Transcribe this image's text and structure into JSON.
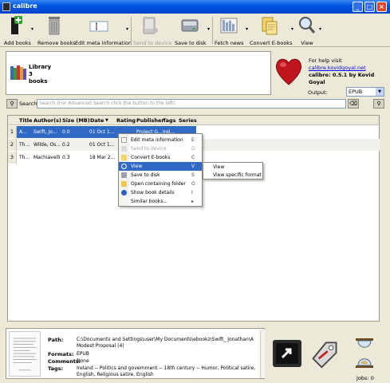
{
  "window": {
    "title": "calibre"
  },
  "toolbar": {
    "add_books": "Add books",
    "remove_books": "Remove books",
    "edit_meta": "Edit meta information",
    "send_to_device": "Send to device",
    "save_to_disk": "Save to disk",
    "fetch_news": "Fetch news",
    "convert_ebooks": "Convert E-books",
    "view": "View"
  },
  "library": {
    "line1": "Library",
    "line2": "3",
    "line3": "books"
  },
  "help": {
    "prefix": "For help visit ",
    "link": "calibre.kovidgoyal.net",
    "version": "calibre: 0.5.1 by Kovid Goyal"
  },
  "output": {
    "label": "Output:",
    "value": "EPUB"
  },
  "search": {
    "label": "Search:",
    "placeholder": "Search (For Advanced Search click the button to the left)"
  },
  "table": {
    "headers": [
      "Title",
      "Author(s)",
      "Size (MB)",
      "Date",
      "Rating",
      "Publisher",
      "Tags",
      "Series"
    ],
    "rows": [
      {
        "num": "1",
        "title": "A...",
        "author": "Swift, Jo...",
        "size": "0.0",
        "date": "01 Oct 1...",
        "publisher": "Project G...",
        "tags": "Irel..."
      },
      {
        "num": "2",
        "title": "Th...",
        "author": "Wilde, Os...",
        "size": "0.2",
        "date": "01 Oct 1...",
        "publisher": "",
        "tags": ""
      },
      {
        "num": "3",
        "title": "Th...",
        "author": "Machiavelli",
        "size": "0.3",
        "date": "18 Mar 2...",
        "publisher": "",
        "tags": ""
      }
    ]
  },
  "context_menu": {
    "items": [
      {
        "label": "Edit meta information",
        "shortcut": "E"
      },
      {
        "label": "Send to device",
        "shortcut": "D"
      },
      {
        "label": "Convert E-books",
        "shortcut": "C"
      },
      {
        "label": "View",
        "shortcut": "V"
      },
      {
        "label": "Save to disk",
        "shortcut": "S"
      },
      {
        "label": "Open containing folder",
        "shortcut": "O"
      },
      {
        "label": "Show book details",
        "shortcut": "I"
      },
      {
        "label": "Similar books...",
        "shortcut": "▸"
      }
    ],
    "submenu": [
      "View",
      "View specific format"
    ]
  },
  "details": {
    "path_label": "Path:",
    "path_value": "C:\\Documents and Settings\\user\\My Documents\\ebookz\\Swift_ Jonathan\\A Modest Proposal (4)",
    "formats_label": "Formats:",
    "formats_value": "EPUB",
    "comments_label": "Comments:",
    "comments_value": "None",
    "tags_label": "Tags:",
    "tags_value": "Ireland -- Politics and government -- 18th century -- Humor, Political satire, English, Religious satire, English"
  },
  "jobs": "Jobs: 0",
  "colors": {
    "selection": "#316ac5",
    "titlebar": "#0054e3",
    "heart": "#c0141e"
  }
}
